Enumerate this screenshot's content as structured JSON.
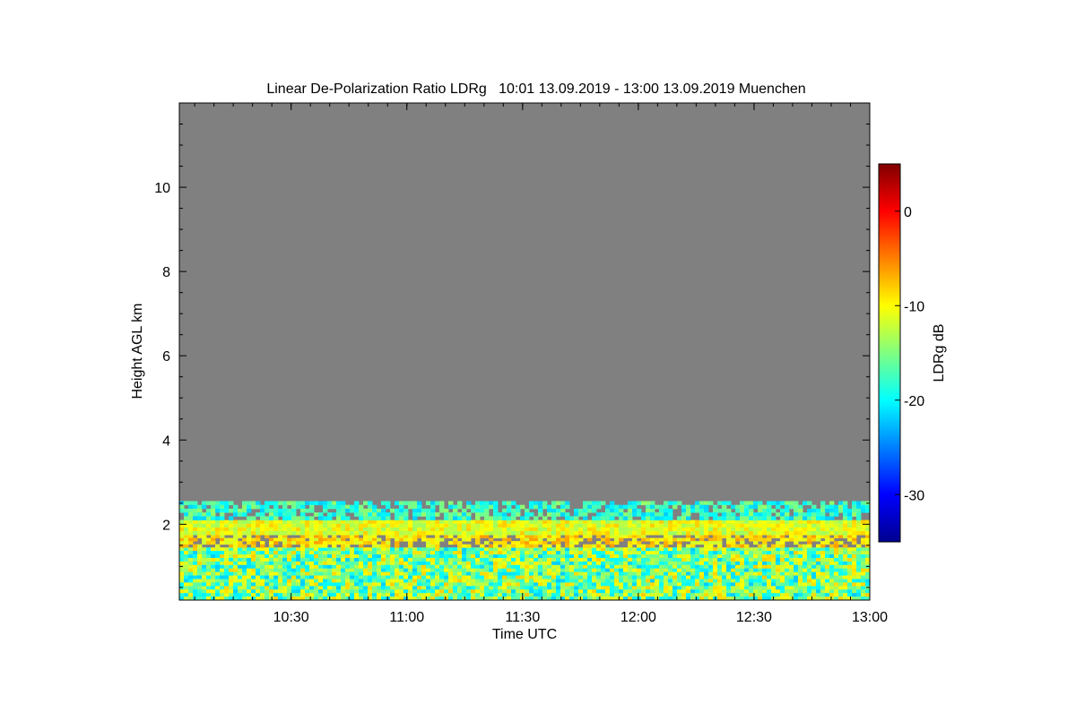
{
  "chart_data": {
    "type": "heatmap",
    "title": "Linear De-Polarization Ratio LDRg   10:01 13.09.2019 - 13:00 13.09.2019 Muenchen",
    "xlabel": "Time UTC",
    "ylabel": "Height AGL km",
    "x_ticks": [
      {
        "value": 10.5,
        "label": "10:30"
      },
      {
        "value": 11.0,
        "label": "11:00"
      },
      {
        "value": 11.5,
        "label": "11:30"
      },
      {
        "value": 12.0,
        "label": "12:00"
      },
      {
        "value": 12.5,
        "label": "12:30"
      },
      {
        "value": 13.0,
        "label": "13:00"
      }
    ],
    "xlim": [
      10.017,
      13.0
    ],
    "y_ticks": [
      {
        "value": 2,
        "label": "2"
      },
      {
        "value": 4,
        "label": "4"
      },
      {
        "value": 6,
        "label": "6"
      },
      {
        "value": 8,
        "label": "8"
      },
      {
        "value": 10,
        "label": "10"
      }
    ],
    "ylim": [
      0.2,
      12.0
    ],
    "grid": false,
    "colorbar": {
      "label": "LDRg dB",
      "range": [
        -35,
        5
      ],
      "ticks": [
        {
          "value": 0,
          "label": "0"
        },
        {
          "value": -10,
          "label": "-10"
        },
        {
          "value": -20,
          "label": "-20"
        },
        {
          "value": -30,
          "label": "-30"
        }
      ],
      "colormap": "jet"
    },
    "background_color": "#808080",
    "layers": [
      {
        "height_range": [
          0.2,
          1.45
        ],
        "ldr_dB_range": [
          -22,
          -8
        ],
        "description": ""
      },
      {
        "height_range": [
          1.45,
          1.75
        ],
        "ldr_dB_range": [
          -12,
          -6
        ]
      },
      {
        "height_range": [
          1.75,
          2.1
        ],
        "ldr_dB_range": [
          -14,
          -8
        ]
      },
      {
        "height_range": [
          2.1,
          2.55
        ],
        "ldr_dB_range": [
          -22,
          -14
        ]
      }
    ]
  }
}
